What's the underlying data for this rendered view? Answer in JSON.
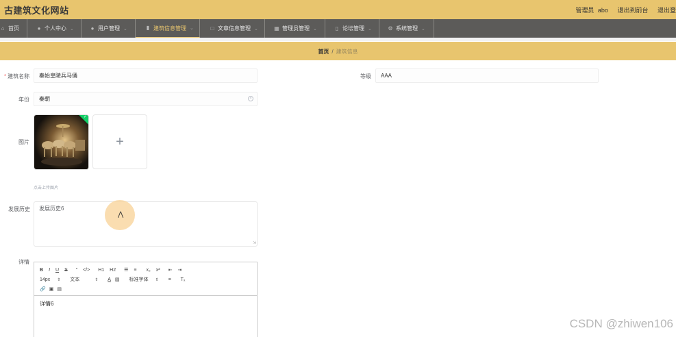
{
  "header": {
    "site_title": "古建筑文化网站",
    "user_role": "管理员",
    "username": "abo",
    "to_front": "退出到前台",
    "logout": "退出登"
  },
  "nav": {
    "items": [
      {
        "label": "首页",
        "icon": "home-icon"
      },
      {
        "label": "个人中心",
        "icon": "user-icon"
      },
      {
        "label": "用户管理",
        "icon": "user-group-icon"
      },
      {
        "label": "建筑信息管理",
        "icon": "pillar-icon",
        "active": true
      },
      {
        "label": "文章信息管理",
        "icon": "crop-icon"
      },
      {
        "label": "管理员管理",
        "icon": "grid-icon"
      },
      {
        "label": "论坛管理",
        "icon": "phone-icon"
      },
      {
        "label": "系统管理",
        "icon": "settings-icon"
      }
    ]
  },
  "breadcrumb": {
    "home": "首页",
    "separator": "/",
    "current": "建筑信息"
  },
  "form": {
    "name": {
      "label": "建筑名称",
      "value": "秦始皇陵兵马俑"
    },
    "level": {
      "label": "等级",
      "value": "AAA"
    },
    "era": {
      "label": "年份",
      "value": "秦朝"
    },
    "image": {
      "label": "图片",
      "tip": "点击上传图片",
      "plus": "+"
    },
    "history": {
      "label": "发展历史",
      "value": "发展历史6"
    },
    "detail": {
      "label": "详情",
      "value": "详情6"
    }
  },
  "editor": {
    "row1": [
      "B",
      "I",
      "U",
      "S",
      "”",
      "</>",
      "H1",
      "H2",
      "☰",
      "≡",
      "x₂",
      "x²",
      "⇤",
      "⇥"
    ],
    "font_size": "14px",
    "text_type": "文本",
    "font_family": "标准字体",
    "row3": [
      "link",
      "image",
      "video"
    ]
  },
  "watermark": "CSDN @zhiwen106"
}
